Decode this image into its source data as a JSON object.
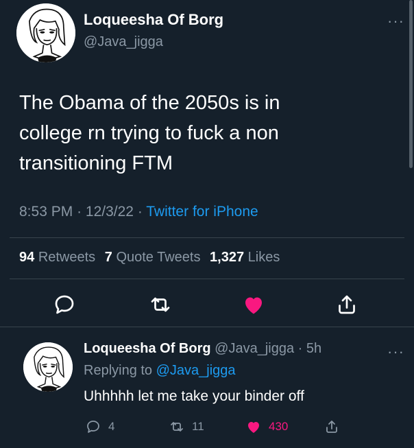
{
  "tweet": {
    "display_name": "Loqueesha Of Borg",
    "handle": "@Java_jigga",
    "text_line1": "The Obama of the 2050s is in",
    "text_line2": "college rn trying to fuck a non",
    "text_line3": "transitioning FTM",
    "time": "8:53 PM",
    "date": "12/3/22",
    "source": "Twitter for iPhone",
    "retweets_count": "94",
    "retweets_label": "Retweets",
    "quotes_count": "7",
    "quotes_label": "Quote Tweets",
    "likes_count": "1,327",
    "likes_label": "Likes",
    "liked": true
  },
  "reply": {
    "display_name": "Loqueesha Of Borg",
    "handle": "@Java_jigga",
    "age": "5h",
    "replying_prefix": "Replying to",
    "replying_handle": "@Java_jigga",
    "text": "Uhhhhh let me take your binder off",
    "reply_count": "4",
    "retweet_count": "11",
    "like_count": "430",
    "liked": true
  },
  "icons": {
    "more": "more-horizontal-icon",
    "reply": "reply-icon",
    "retweet": "retweet-icon",
    "like": "heart-icon",
    "share": "share-icon"
  },
  "colors": {
    "background": "#15202b",
    "text": "#ffffff",
    "secondary": "#8b98a5",
    "link": "#1d9bf0",
    "like": "#f91880",
    "divider": "#38444d"
  }
}
